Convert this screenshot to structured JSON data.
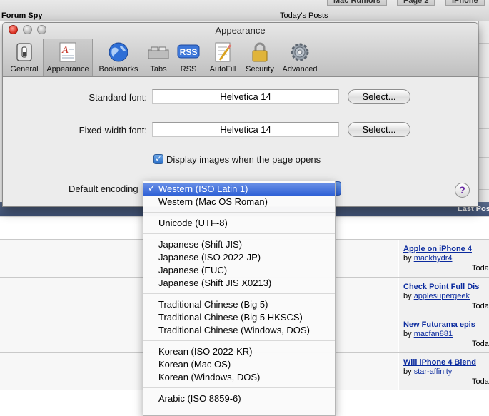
{
  "background": {
    "site_name": "Forum Spy",
    "section_title": "Today's Posts",
    "tabs": [
      "Mac Rumors",
      "Page 2",
      "iPhone"
    ],
    "last_post_header": "Last Post",
    "posts": [
      {
        "title": "Apple on iPhone 4",
        "by": "by",
        "user": "mackhydr4",
        "date": "Toda"
      },
      {
        "title": "Check Point Full Dis",
        "by": "by",
        "user": "applesupergeek",
        "date": "Toda"
      },
      {
        "title": "New Futurama epis",
        "by": "by",
        "user": "macfan881",
        "date": "Toda"
      },
      {
        "title": "Will iPhone 4 Blend",
        "by": "by",
        "user": "star-affinity",
        "date": "Toda"
      }
    ]
  },
  "window": {
    "title": "Appearance",
    "toolbar": [
      {
        "label": "General",
        "icon": "switch-icon"
      },
      {
        "label": "Appearance",
        "icon": "font-document-icon",
        "selected": true
      },
      {
        "label": "Bookmarks",
        "icon": "globe-icon"
      },
      {
        "label": "Tabs",
        "icon": "tabs-icon"
      },
      {
        "label": "RSS",
        "icon": "rss-icon"
      },
      {
        "label": "AutoFill",
        "icon": "pencil-form-icon"
      },
      {
        "label": "Security",
        "icon": "lock-icon"
      },
      {
        "label": "Advanced",
        "icon": "gear-icon"
      }
    ],
    "standard_font_label": "Standard font:",
    "standard_font_value": "Helvetica 14",
    "fixed_font_label": "Fixed-width font:",
    "fixed_font_value": "Helvetica 14",
    "select_label": "Select...",
    "display_images_label": "Display images when the page opens",
    "display_images_checked": true,
    "encoding_label": "Default encoding",
    "help_label": "?"
  },
  "encoding_menu": {
    "check": "✓",
    "selected": "Western (ISO Latin 1)",
    "groups": [
      [
        "Western (Mac OS Roman)"
      ],
      [
        "Unicode (UTF-8)"
      ],
      [
        "Japanese (Shift JIS)",
        "Japanese (ISO 2022-JP)",
        "Japanese (EUC)",
        "Japanese (Shift JIS X0213)"
      ],
      [
        "Traditional Chinese (Big 5)",
        "Traditional Chinese (Big 5 HKSCS)",
        "Traditional Chinese (Windows, DOS)"
      ],
      [
        "Korean (ISO 2022-KR)",
        "Korean (Mac OS)",
        "Korean (Windows, DOS)"
      ],
      [
        "Arabic (ISO 8859-6)"
      ]
    ]
  },
  "colors": {
    "accent": "#2f61d6",
    "link": "#0a2a9e",
    "forum_bar": "#4a5b80"
  }
}
